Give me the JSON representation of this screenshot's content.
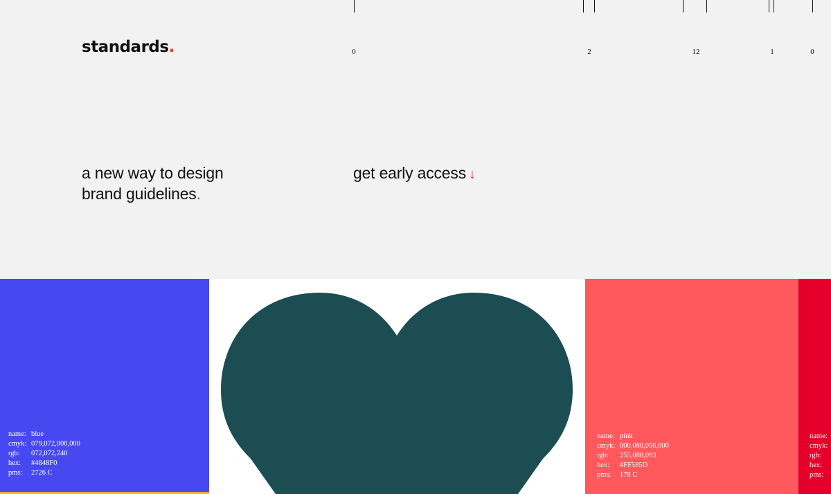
{
  "brand": {
    "name": "standards",
    "dot": "."
  },
  "ruler": {
    "labels": [
      {
        "text": "0"
      },
      {
        "text": "2"
      },
      {
        "text": "12"
      },
      {
        "text": "1"
      },
      {
        "text": "0"
      }
    ]
  },
  "hero": {
    "tagline_line1": "a new way to design",
    "tagline_line2": "brand guidelines",
    "tagline_dot": ".",
    "cta_label": "get early access",
    "cta_arrow": "↓"
  },
  "swatches": {
    "blue": {
      "color": "#4848F0",
      "name_key": "name:",
      "name": "blue",
      "cmyk_key": "cmyk:",
      "cmyk": "079,072,000,000",
      "rgb_key": "rgb:",
      "rgb": "072,072,240",
      "hex_key": "hex:",
      "hex": "#4848F0",
      "pms_key": "pms:",
      "pms": "2726 C"
    },
    "heart": {
      "color": "#1b4d52",
      "icon": "heart-icon"
    },
    "pink": {
      "color": "#FF585D",
      "name_key": "name:",
      "name": "pink",
      "cmyk_key": "cmyk:",
      "cmyk": "000,080,056,000",
      "rgb_key": "rgb:",
      "rgb": "255,088,093",
      "hex_key": "hex:",
      "hex": "#FF585D",
      "pms_key": "pms:",
      "pms": "178 C"
    },
    "red": {
      "name_key": "name:",
      "cmyk_key": "cmyk:",
      "rgb_key": "rgb:",
      "hex_key": "hex:",
      "pms_key": "pms:"
    }
  },
  "colors": {
    "accent": "#e8412f",
    "background": "#f2f2f2",
    "red_swatch": "#e4002b"
  }
}
